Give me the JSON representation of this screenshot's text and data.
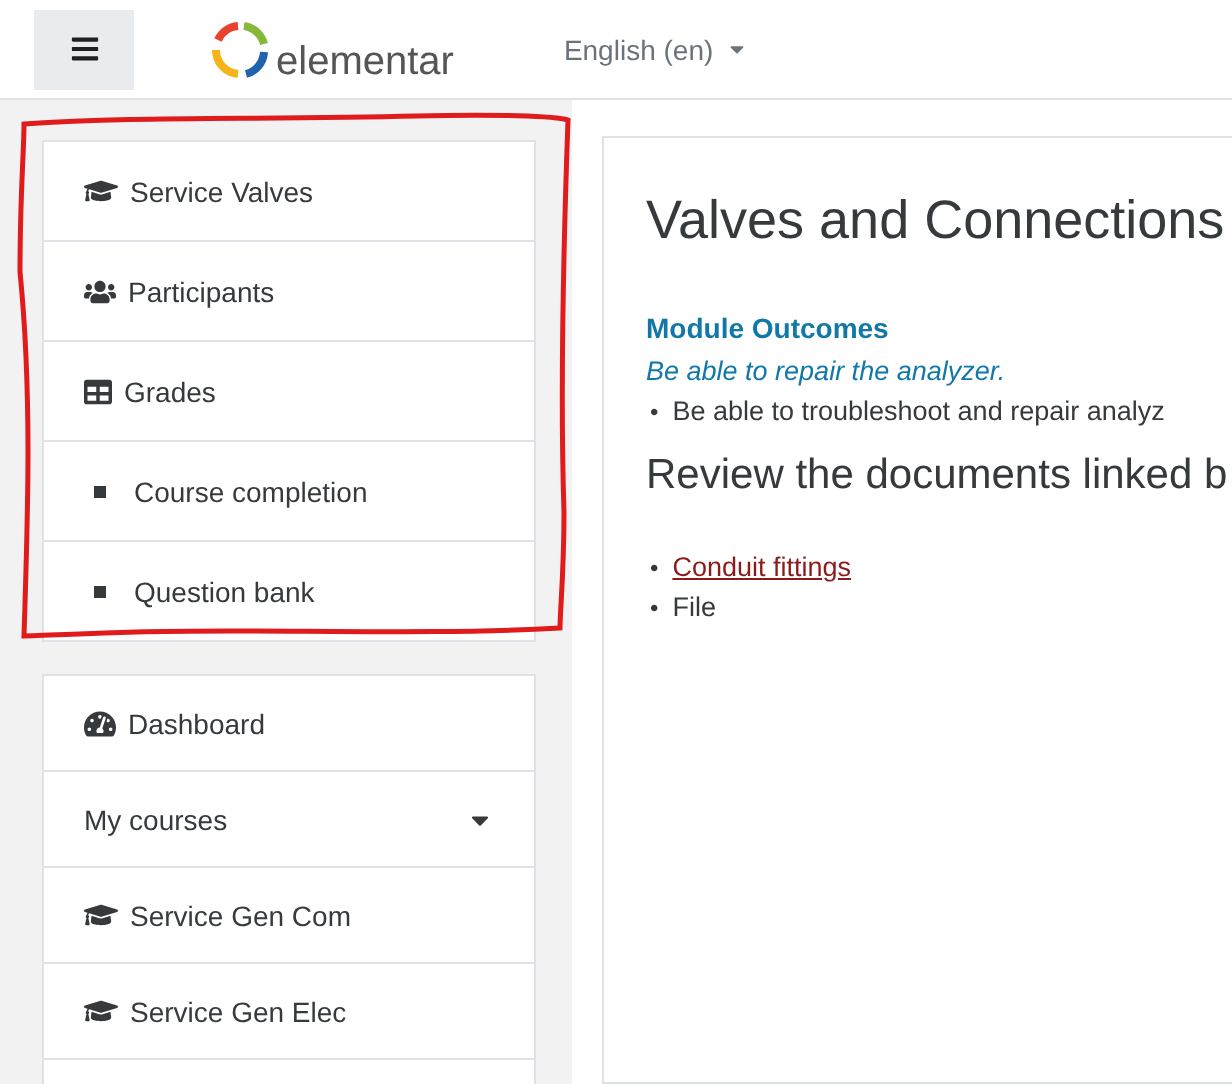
{
  "header": {
    "logo_text": "elementar",
    "language": "English (en)"
  },
  "nav_groups": [
    {
      "highlighted": true,
      "items": [
        {
          "kind": "course",
          "label": "Service Valves"
        },
        {
          "kind": "participants",
          "label": "Participants"
        },
        {
          "kind": "grades",
          "label": "Grades"
        },
        {
          "kind": "bullet",
          "label": "Course completion"
        },
        {
          "kind": "bullet",
          "label": "Question bank"
        }
      ]
    },
    {
      "highlighted": false,
      "items": [
        {
          "kind": "dashboard",
          "label": "Dashboard"
        },
        {
          "kind": "dropdown",
          "label": "My courses"
        },
        {
          "kind": "course",
          "label": "Service Gen Com"
        },
        {
          "kind": "course",
          "label": "Service Gen Elec"
        },
        {
          "kind": "empty"
        }
      ]
    }
  ],
  "content": {
    "title": "Valves and Connections",
    "section_heading": "Module Outcomes",
    "outcome": "Be able to repair the analyzer.",
    "outcome_bullets": [
      {
        "marker": "•",
        "text": "Be able to troubleshoot and repair analyz"
      }
    ],
    "subheading": "Review the documents linked b",
    "documents": [
      {
        "kind": "link",
        "marker": "•",
        "text": "Conduit fittings"
      },
      {
        "kind": "text",
        "marker": "•",
        "text": "File"
      }
    ]
  }
}
